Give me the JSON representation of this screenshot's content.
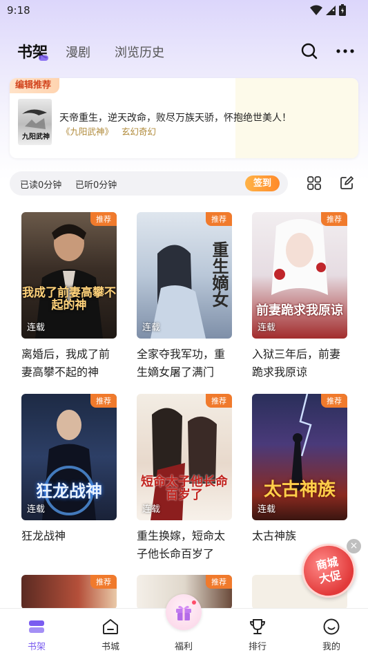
{
  "status": {
    "time": "9:18"
  },
  "header": {
    "tabs": [
      {
        "label": "书架",
        "active": true
      },
      {
        "label": "漫剧"
      },
      {
        "label": "浏览历史"
      }
    ],
    "icons": [
      "search-icon",
      "more-icon"
    ]
  },
  "recommend": {
    "badge": "编辑推荐",
    "description": "天帝重生，逆天改命，败尽万族天骄，怀抱绝世美人！",
    "book_name": "《九阳武神》",
    "genre": "玄幻奇幻"
  },
  "stats": {
    "read": "已读0分钟",
    "listen": "已听0分钟",
    "sign_button": "签到"
  },
  "books": [
    {
      "title": "离婚后，我成了前妻高攀不起的神",
      "tag": "推荐",
      "status": "连载",
      "cover_text": "我成了前妻高攀不起的神"
    },
    {
      "title": "全家夺我军功，重生嫡女屠了满门",
      "tag": "推荐",
      "status": "连载",
      "cover_text": "重生嫡女"
    },
    {
      "title": "入狱三年后，前妻跪求我原谅",
      "tag": "推荐",
      "status": "连载",
      "cover_text": "前妻跪求我原谅"
    },
    {
      "title": "狂龙战神",
      "tag": "推荐",
      "status": "连载",
      "cover_text": "狂龙战神"
    },
    {
      "title": "重生换嫁，短命太子他长命百岁了",
      "tag": "推荐",
      "status": "连载",
      "cover_text": "短命太子他长命百岁了"
    },
    {
      "title": "太古神族",
      "tag": "推荐",
      "status": "连载",
      "cover_text": "太古神族"
    },
    {
      "title": "",
      "tag": "推荐",
      "status": "",
      "cover_text": ""
    },
    {
      "title": "",
      "tag": "推荐",
      "status": "",
      "cover_text": ""
    }
  ],
  "promo": {
    "line1": "商城",
    "line2": "大促",
    "close": "×"
  },
  "nav": [
    {
      "label": "书架",
      "icon": "bookshelf-icon",
      "active": true
    },
    {
      "label": "书城",
      "icon": "store-icon"
    },
    {
      "label": "福利",
      "icon": "gift-icon"
    },
    {
      "label": "排行",
      "icon": "trophy-icon"
    },
    {
      "label": "我的",
      "icon": "profile-icon"
    }
  ],
  "colors": {
    "accent": "#7a5cf0",
    "tag": "#f07a2c",
    "sign": "#ff8a2a"
  }
}
